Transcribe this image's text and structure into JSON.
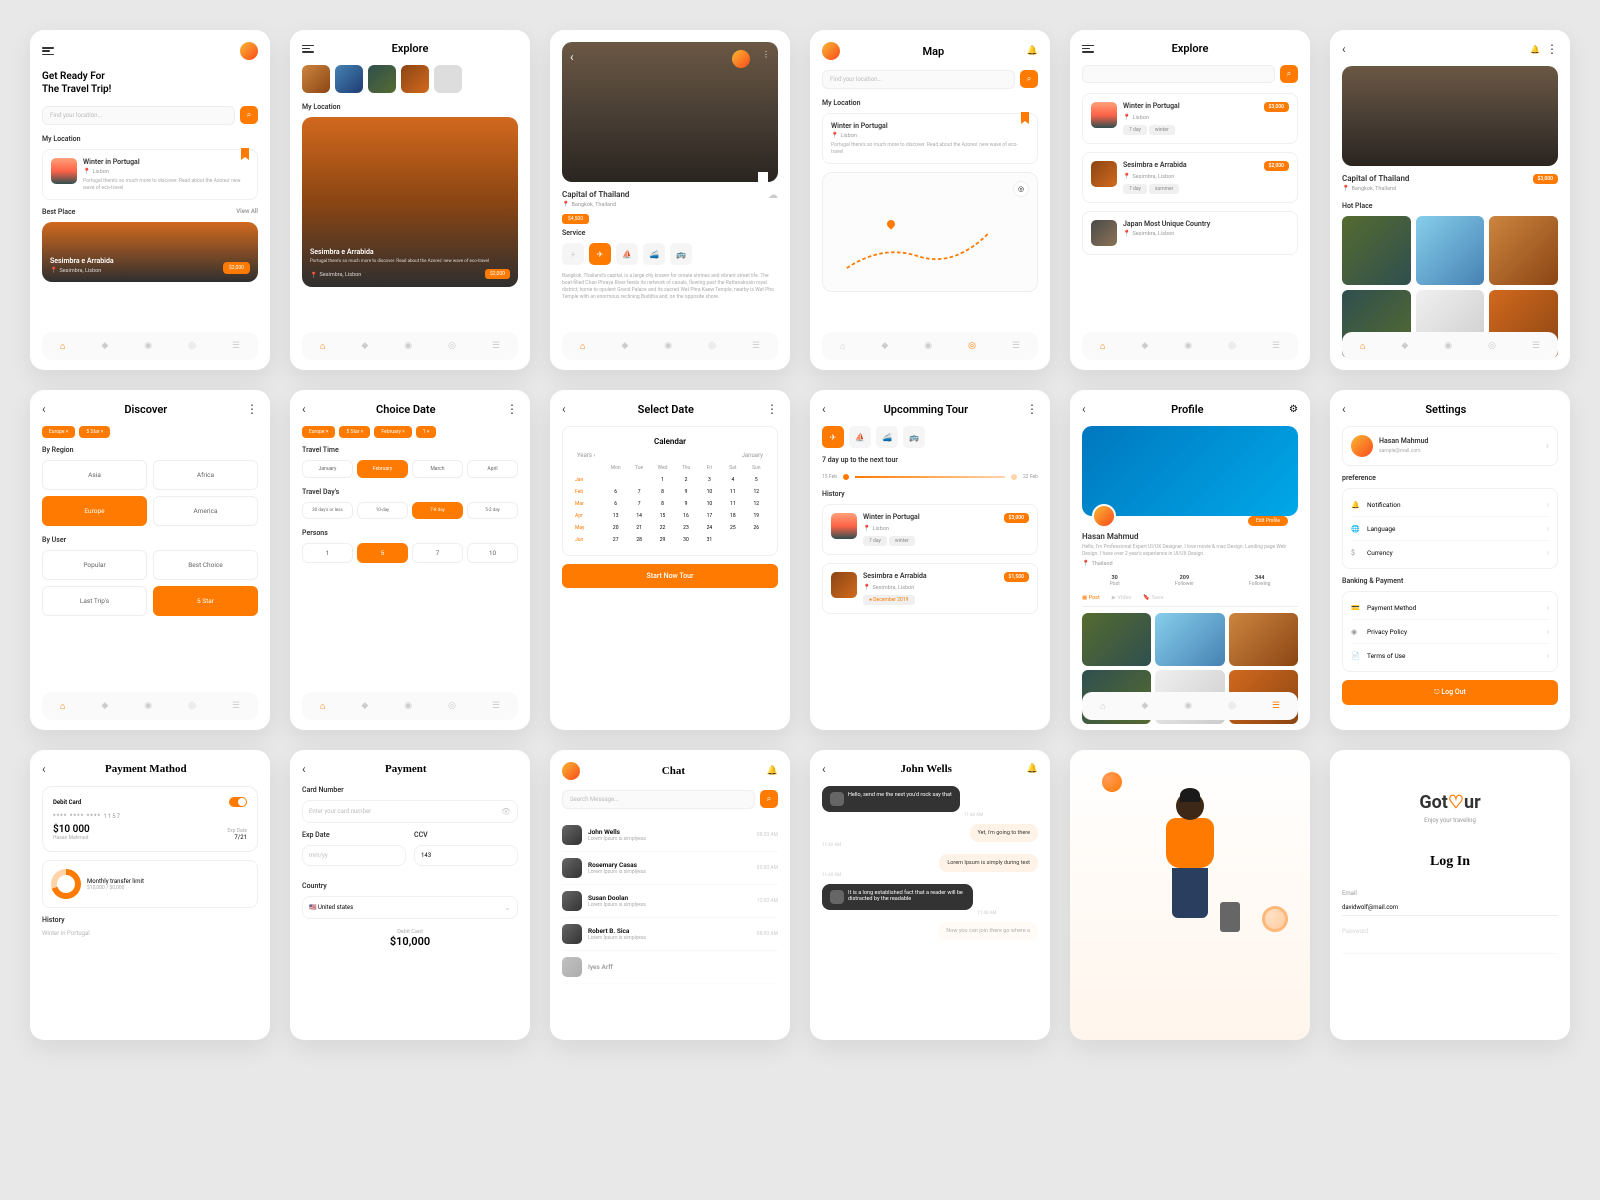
{
  "s1": {
    "title1": "Get Ready For",
    "title2": "The Travel Trip!",
    "search": "Find your location...",
    "myloc": "My Location",
    "c1": {
      "t": "Winter in Portugal",
      "s": "Lisbon",
      "d": "Portugal there's so much more to discover. Read about the Azores' new wave of eco-travel"
    },
    "best": "Best Place",
    "view": "View All",
    "c2": {
      "t": "Sesimbra e Arrabida",
      "s": "Sesimbra, Lisbon",
      "p": "$2,000"
    }
  },
  "s2": {
    "h": "Explore",
    "myloc": "My Location",
    "c": {
      "t": "Sesimbra e Arrabida",
      "d": "Portugal there's so much more to discover. Read about the Azores' new wave of eco-travel",
      "s": "Sesimbra, Lisbon",
      "p": "$2,000"
    }
  },
  "s3": {
    "t": "Capital of Thailand",
    "s": "Bangkok, Thailand",
    "p": "$4,500",
    "svc": "Service",
    "d": "Bangkok, Thailand's capital, is a large city known for ornate shrines and vibrant street life. The boat-filled Chao Phraya River feeds its network of canals, flowing past the Rattanakosin royal district, home to opulent Grand Palace and its sacred Wat Phra Kaew Temple, nearby is Wat Pho Temple with an enormous reclining Buddha and, on the opposite shore."
  },
  "s4": {
    "h": "Map",
    "search": "Find your location...",
    "myloc": "My Location",
    "c": {
      "t": "Winter in Portugal",
      "s": "Lisbon",
      "d": "Portugal there's so much more to discover. Read about the Azores' new wave of eco-travel"
    }
  },
  "s5": {
    "h": "Explore",
    "search": "",
    "c1": {
      "t": "Winter in Portugal",
      "s": "Lisbon",
      "p": "$3,000",
      "t1": "7 day",
      "t2": "winter"
    },
    "c2": {
      "t": "Sesimbra e Arrabida",
      "s": "Sesimbra, Lisbon",
      "p": "$2,000",
      "t1": "7 day",
      "t2": "summer"
    },
    "c3": {
      "t": "Japan Most Unique Country",
      "s": "Sesimbra, Lisbon"
    }
  },
  "s6": {
    "t": "Capital of Thailand",
    "s": "Bangkok, Thailand",
    "p": "$3,000",
    "hot": "Hot Place"
  },
  "s7": {
    "h": "Discover",
    "ch": [
      "Europe ×",
      "5 Star ×"
    ],
    "r": "By Region",
    "regions": [
      "Asia",
      "Africa",
      "Europe",
      "America"
    ],
    "u": "By User",
    "users": [
      "Popular",
      "Best Choice",
      "Last Trip's",
      "5 Star"
    ]
  },
  "s8": {
    "h": "Choice Date",
    "ch": [
      "Europe ×",
      "5 Star ×",
      "February ×",
      "1 ×"
    ],
    "tt": "Travel Time",
    "months": [
      "January",
      "February",
      "March",
      "April"
    ],
    "td": "Travel Day's",
    "days": [
      "30 day's or less",
      "10-day",
      "7-8 day",
      "5-2 day"
    ],
    "p": "Persons",
    "persons": [
      "1",
      "5",
      "7",
      "10"
    ]
  },
  "s9": {
    "h": "Select Date",
    "cal": "Calendar",
    "y": "Years ‹",
    "m": "January",
    "days": [
      "Mon",
      "Tue",
      "Wed",
      "Thu",
      "Fri",
      "Sat",
      "Sun"
    ],
    "months": [
      "Jan",
      "Feb",
      "Mar",
      "Apr",
      "May",
      "Jun"
    ],
    "btn": "Start Now Tour"
  },
  "s10": {
    "h": "Upcomming Tour",
    "next": "7 day up to the next tour",
    "d1": "15 Feb",
    "d2": "22 Feb",
    "hist": "History",
    "c1": {
      "t": "Winter in Portugal",
      "s": "Lisbon",
      "p": "$3,000",
      "t1": "7 day",
      "t2": "winter"
    },
    "c2": {
      "t": "Sesimbra e Arrabida",
      "s": "Sesimbra, Lisbon",
      "p": "$1,500",
      "t1": "December 2019"
    }
  },
  "s11": {
    "h": "Profile",
    "name": "Hasan Mahmud",
    "ep": "Edit Profile",
    "bio": "Hello, I'm Professional Expert UI/UX Designer. I love movie & mac Design. Landing page Web Design. I have over 2 year's experience in UI/UX Design.",
    "loc": "Thailand",
    "s1n": "30",
    "s1l": "Post",
    "s2n": "209",
    "s2l": "Follower",
    "s3n": "344",
    "s3l": "Following",
    "t1": "Post",
    "t2": "Video",
    "t3": "Save"
  },
  "s12": {
    "h": "Settings",
    "name": "Hasan Mahmud",
    "email": "sample@mail.com",
    "pref": "preference",
    "i1": "Notification",
    "i2": "Language",
    "i3": "Currency",
    "bank": "Banking & Payment",
    "i4": "Payment Method",
    "i5": "Privacy Policy",
    "i6": "Terms of Use",
    "btn": "Log Out"
  },
  "s13": {
    "h": "Payment Mathod",
    "dc": "Debit Card",
    "cn": "**** **** **** 1157",
    "amt": "$10 000",
    "holder": "Hasan Mahmud",
    "ed": "Exp Date",
    "edv": "7/21",
    "mtl": "Monthly transfer limit",
    "mtlv": "$10,000 / $0,000",
    "hist": "History",
    "hi": "Winter in Portugal"
  },
  "s14": {
    "h": "Payment",
    "cn": "Card Number",
    "cnp": "Enter your card number",
    "ed": "Exp Date",
    "edv": "mm/yy",
    "ccv": "CCV",
    "ccvv": "143",
    "co": "Country",
    "cov": "United states",
    "dc": "Debit Card",
    "amt": "$10,000"
  },
  "s15": {
    "h": "Chat",
    "search": "Search Message...",
    "c": [
      {
        "n": "John Wells",
        "m": "Lorem Ipsum is simplyess",
        "t": "08:00 AM"
      },
      {
        "n": "Rosemary Casas",
        "m": "Lorem Ipsum is simplyess",
        "t": "05:00 AM"
      },
      {
        "n": "Susan Doolan",
        "m": "Lorem Ipsum is simplyess",
        "t": "12:00 AM"
      },
      {
        "n": "Robert B. Sica",
        "m": "Lorem Ipsum is simplyess",
        "t": "08:00 AM"
      },
      {
        "n": "Iyes Arff",
        "m": "",
        "t": ""
      }
    ]
  },
  "s16": {
    "h": "John Wells",
    "m1": "Hello, send me the next you'd rock say that",
    "t1": "11:40 AM",
    "m2": "Yet, i'm going to there",
    "t2": "11:40 AM",
    "m3": "Lorem Ipsum is simply during text",
    "t3": "11:40 AM",
    "m4": "It is a long established fact that a reader will be distracted by the readable",
    "t4": "11:40 AM",
    "m5": "Now you can join there go where a"
  },
  "s18": {
    "brand": "Got",
    "brand2": "ur",
    "tag": "Enjoy your traveling",
    "h": "Log In",
    "e": "Email",
    "ev": "davidwolf@mail.com",
    "p": "Password"
  }
}
